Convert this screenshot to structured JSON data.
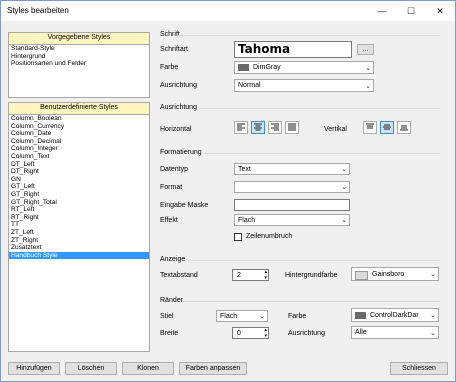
{
  "window": {
    "title": "Styles bearbeiten",
    "min": "—",
    "max": "☐",
    "close": "✕"
  },
  "predef": {
    "header": "Vorgegebene Styles",
    "items": [
      "Standard-Style",
      "Hintergrund",
      "Positionsarten und Felder"
    ]
  },
  "user": {
    "header": "Benutzerdefinierte Styles",
    "items": [
      "Column_Boolean",
      "Column_Currency",
      "Column_Date",
      "Column_Decimal",
      "Column_Integer",
      "Column_Text",
      "DT_Left",
      "DT_Right",
      "GN",
      "GT_Left",
      "GT_Right",
      "GT_Right_Total",
      "RT_Left",
      "RT_Right",
      "TT",
      "ZT_Left",
      "ZT_Right",
      "Zusatztext",
      "Handbuch Style"
    ],
    "selected": "Handbuch Style"
  },
  "schrift": {
    "group": "Schrift",
    "font_label": "Schriftart",
    "font_value": "Tahoma",
    "browse": "...",
    "color_label": "Farbe",
    "color_value": "DimGray",
    "color_hex": "#696969",
    "align_label": "Ausrichtung",
    "align_value": "Normal"
  },
  "ausrichtung": {
    "group": "Ausrichtung",
    "horizontal": "Horizontal",
    "vertikal": "Vertikal"
  },
  "formatierung": {
    "group": "Formatierung",
    "datatype_label": "Datentyp",
    "datatype_value": "Text",
    "format_label": "Format",
    "format_value": "",
    "mask_label": "Eingabe Maske",
    "mask_value": "",
    "effect_label": "Effekt",
    "effect_value": "Flach",
    "wrap_label": "Zeilenumbruch"
  },
  "anzeige": {
    "group": "Anzeige",
    "spacing_label": "Textabstand",
    "spacing_value": "2",
    "bg_label": "Hintergrundfarbe",
    "bg_value": "Gainsboro",
    "bg_hex": "#dcdcdc"
  },
  "raender": {
    "group": "Ränder",
    "style_label": "Stiel",
    "style_value": "Flach",
    "width_label": "Breite",
    "width_value": "0",
    "color_label": "Farbe",
    "color_value": "ControlDarkDar",
    "color_hex": "#696969",
    "align_label": "Ausrichtung",
    "align_value": "Alle"
  },
  "buttons": {
    "add": "Hinzufügen",
    "delete": "Löschen",
    "clone": "Klonen",
    "adjust": "Farben anpassen",
    "close": "Schliessen"
  }
}
